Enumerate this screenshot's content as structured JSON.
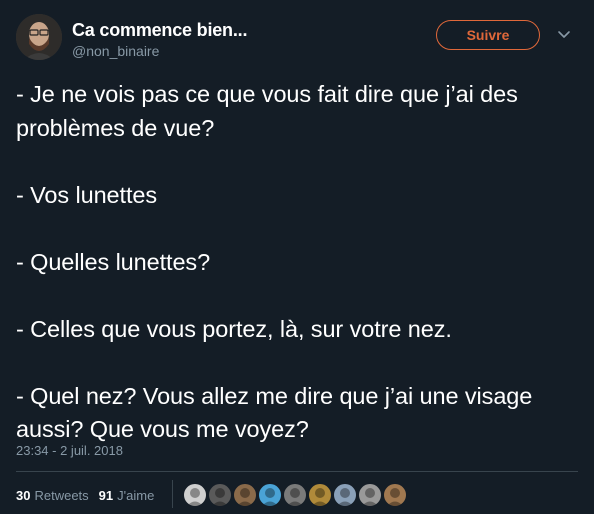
{
  "tweet": {
    "author": {
      "name": "Ca commence bien...",
      "handle": "@non_binaire"
    },
    "follow_label": "Suivre",
    "lines": [
      "- Je ne vois pas ce que vous fait dire que j’ai des problèmes de vue?",
      "",
      "- Vos lunettes",
      "",
      "- Quelles lunettes?",
      "",
      "- Celles que vous portez, là, sur votre nez.",
      "",
      "- Quel nez? Vous allez me dire que j’ai une visage aussi? Que vous me voyez?"
    ],
    "timestamp": "23:34 - 2 juil. 2018",
    "retweets": {
      "count": "30",
      "label": "Retweets"
    },
    "likes": {
      "count": "91",
      "label": "J'aime"
    },
    "liker_avatars": [
      {
        "color": "#cfcfcf"
      },
      {
        "color": "#5a5a5a"
      },
      {
        "color": "#8a6a4a"
      },
      {
        "color": "#4aa3d6"
      },
      {
        "color": "#7a7a7a"
      },
      {
        "color": "#b08a3a"
      },
      {
        "color": "#8aa0b8"
      },
      {
        "color": "#9a9a9a"
      },
      {
        "color": "#a07850"
      }
    ]
  },
  "colors": {
    "background": "#141d26",
    "accent": "#e0683a",
    "muted": "#8899a6",
    "divider": "#38444d"
  }
}
